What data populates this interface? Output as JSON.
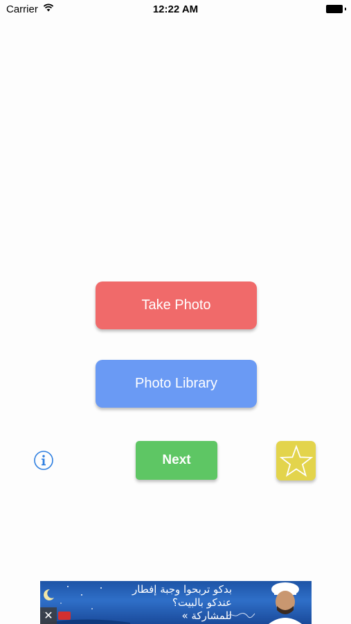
{
  "status_bar": {
    "carrier": "Carrier",
    "time": "12:22 AM"
  },
  "main": {
    "take_photo_label": "Take Photo",
    "photo_library_label": "Photo Library",
    "next_label": "Next",
    "info_icon": "info-icon",
    "star_icon": "star-icon"
  },
  "ad": {
    "text": "بدكو تربحوا وجبة إفطار\nعندكو بالبيت؟\nللمشاركة »",
    "close_symbol": "✕"
  },
  "colors": {
    "take_photo": "#f06a6a",
    "photo_library": "#6a9af4",
    "next": "#5ec664",
    "star": "#e3d44c",
    "info": "#2d7ee0"
  }
}
